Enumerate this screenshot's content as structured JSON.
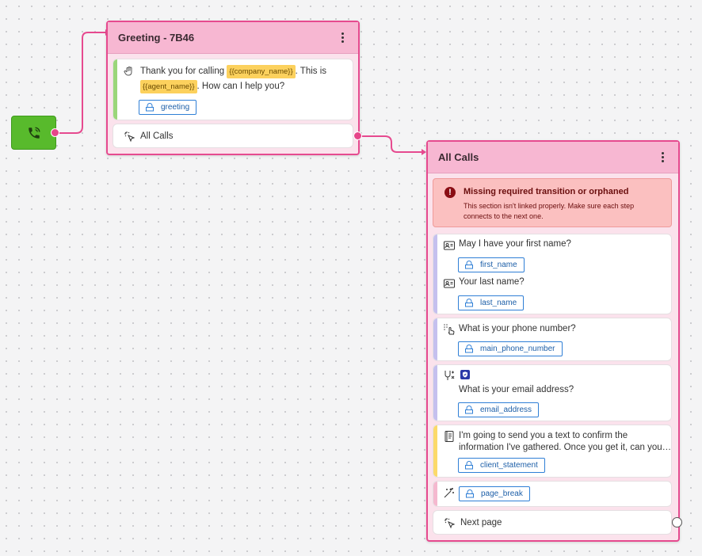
{
  "start_node": {
    "icon": "phone-call-icon"
  },
  "greeting_node": {
    "title": "Greeting - 7B46",
    "message": {
      "text_1": "Thank you for calling",
      "var_1": "{{company_name}}",
      "text_2": ". This is",
      "var_2": "{{agent_name}}",
      "text_3": ". How can I help you?",
      "slot": "greeting",
      "icon": "hand-wave-icon"
    },
    "route": {
      "label": "All Calls",
      "icon": "click-icon"
    }
  },
  "all_calls_node": {
    "title": "All Calls",
    "alert": {
      "title": "Missing required transition or orphaned",
      "message": "This section isn't linked properly. Make sure each step connects to the next one.",
      "icon": "error-icon"
    },
    "steps": [
      {
        "question": "May I have your first name?",
        "slot": "first_name",
        "icon": "contact-card-icon"
      },
      {
        "question": "Your last name?",
        "slot": "last_name",
        "icon": "contact-card-icon"
      },
      {
        "question": "What is your phone number?",
        "slot": "main_phone_number",
        "icon": "touch-dial-icon"
      },
      {
        "question": "What is your email address?",
        "slot": "email_address",
        "icon": "regex-icon",
        "badge_icon": "shield-icon"
      },
      {
        "question_line_1": "I'm going to send you a text to confirm the",
        "question_line_2": "information I've gathered. Once you get it, can you…",
        "slot": "client_statement",
        "icon": "notebook-icon"
      },
      {
        "slot": "page_break",
        "icon": "magic-wand-icon"
      }
    ],
    "route": {
      "label": "Next page",
      "icon": "click-icon"
    }
  },
  "colors": {
    "node_border": "#e64a8f",
    "node_header": "#f7b7d2",
    "start_node": "#58ba2c",
    "greeting_stripe": "#9bd67a",
    "question_stripe": "#c5c0ee",
    "statement_stripe": "#fcd96a",
    "pagebreak_stripe": "#f5b8cf",
    "alert_bg": "#fbc0c0"
  }
}
